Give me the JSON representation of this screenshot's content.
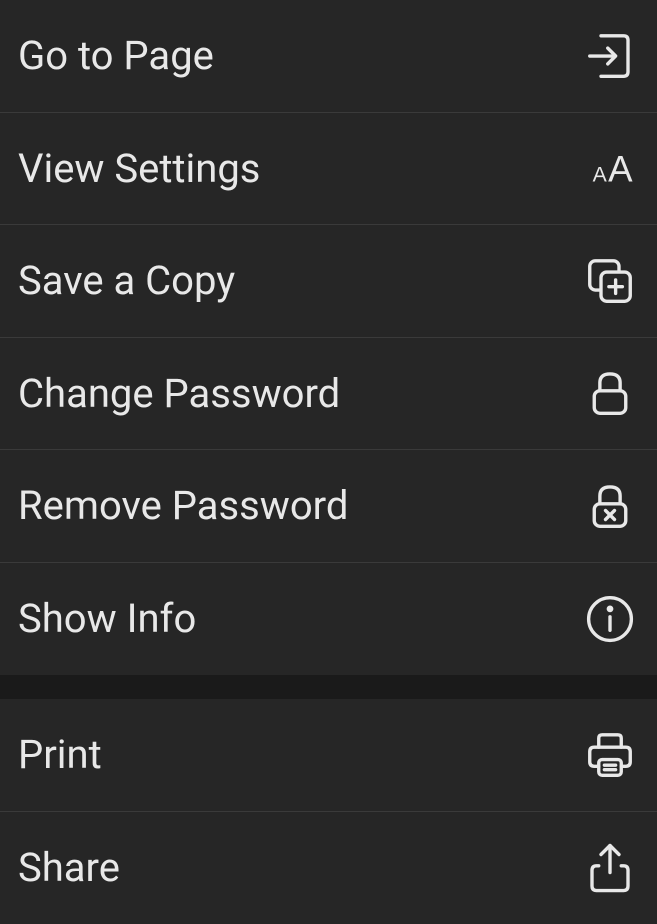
{
  "menu": {
    "group1": [
      {
        "id": "go-to-page",
        "label": "Go to Page",
        "icon": "page-arrow-icon"
      },
      {
        "id": "view-settings",
        "label": "View Settings",
        "icon": "text-size-icon"
      },
      {
        "id": "save-copy",
        "label": "Save a Copy",
        "icon": "copy-plus-icon"
      },
      {
        "id": "change-password",
        "label": "Change Password",
        "icon": "lock-icon"
      },
      {
        "id": "remove-password",
        "label": "Remove Password",
        "icon": "lock-x-icon"
      },
      {
        "id": "show-info",
        "label": "Show Info",
        "icon": "info-icon"
      }
    ],
    "group2": [
      {
        "id": "print",
        "label": "Print",
        "icon": "printer-icon"
      },
      {
        "id": "share",
        "label": "Share",
        "icon": "share-icon"
      }
    ]
  }
}
